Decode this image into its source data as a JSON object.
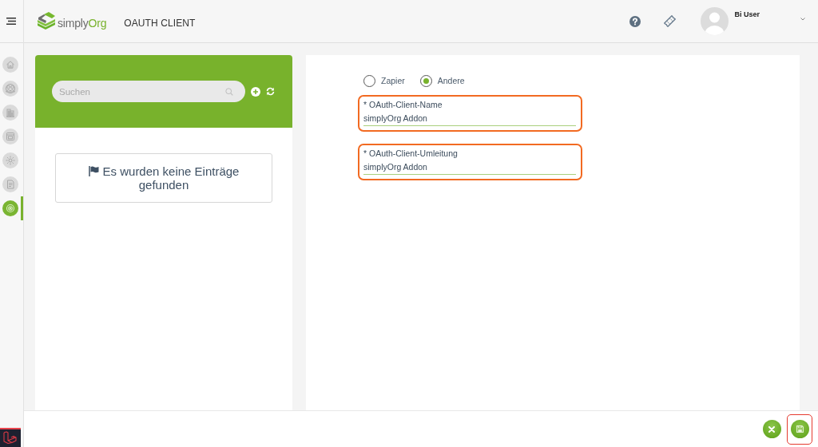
{
  "sidebar": {
    "items": [
      {
        "kind": "home",
        "selected": false
      },
      {
        "kind": "people",
        "selected": false
      },
      {
        "kind": "building",
        "selected": false
      },
      {
        "kind": "calendar",
        "selected": false
      },
      {
        "kind": "sun",
        "selected": false
      },
      {
        "kind": "document",
        "selected": false
      },
      {
        "kind": "target",
        "selected": true
      }
    ]
  },
  "header": {
    "logo": {
      "text": "simply",
      "accent": "Org"
    },
    "title": "OAUTH CLIENT",
    "user": {
      "name": "Bi User"
    }
  },
  "list_panel": {
    "search": {
      "placeholder": "Suchen"
    },
    "empty_message": "Es wurden keine Einträge gefunden"
  },
  "form": {
    "type_options": [
      {
        "label": "Zapier",
        "selected": false
      },
      {
        "label": "Andere",
        "selected": true
      }
    ],
    "fields": [
      {
        "label": "* OAuth-Client-Name",
        "value": "simplyOrg Addon",
        "highlighted": true
      },
      {
        "label": "* OAuth-Client-Umleitung",
        "value": "simplyOrg Addon",
        "highlighted": true
      }
    ]
  },
  "footer": {
    "buttons": [
      {
        "kind": "cancel",
        "highlighted": false
      },
      {
        "kind": "save",
        "highlighted": true
      }
    ]
  }
}
